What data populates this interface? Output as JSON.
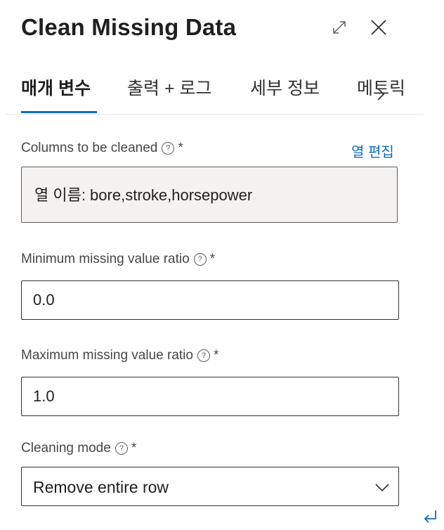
{
  "header": {
    "title": "Clean Missing Data",
    "expand_icon": "expand-icon",
    "close_icon": "close-icon"
  },
  "tabs": [
    {
      "label": "매개 변수",
      "active": true
    },
    {
      "label": "출력 + 로그",
      "active": false
    },
    {
      "label": "세부 정보",
      "active": false
    },
    {
      "label": "메트릭",
      "active": false
    }
  ],
  "fields": {
    "columns": {
      "label": "Columns to be cleaned",
      "required": "*",
      "edit_link": "열 편집",
      "value": "열 이름: bore,stroke,horsepower"
    },
    "min_ratio": {
      "label": "Minimum missing value ratio",
      "required": "*",
      "value": "0.0"
    },
    "max_ratio": {
      "label": "Maximum missing value ratio",
      "required": "*",
      "value": "1.0"
    },
    "cleaning_mode": {
      "label": "Cleaning mode",
      "required": "*",
      "value": "Remove entire row"
    }
  },
  "colors": {
    "accent": "#0f6cbd",
    "text": "#323130",
    "readonly_bg": "#f3f2f1"
  }
}
